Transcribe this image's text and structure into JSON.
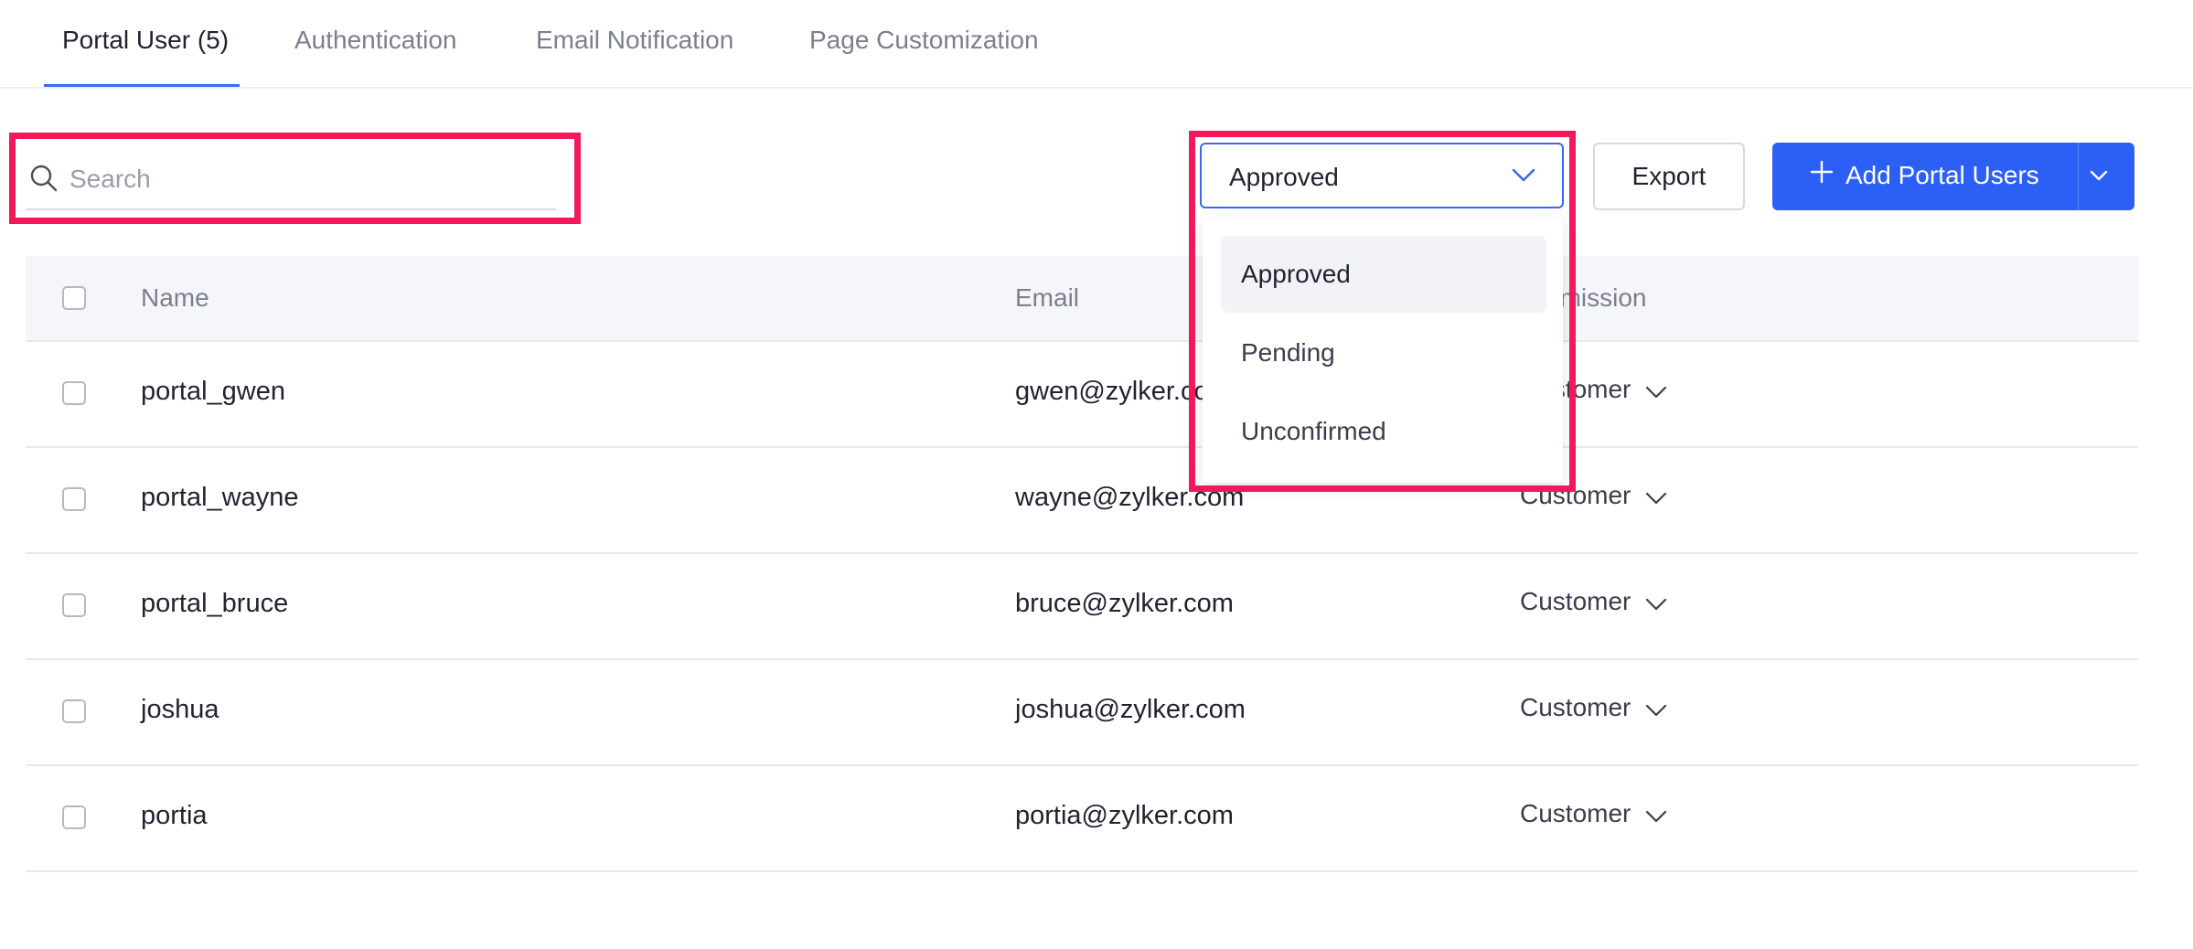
{
  "tabs": [
    {
      "label": "Portal User (5)",
      "active": true
    },
    {
      "label": "Authentication",
      "active": false
    },
    {
      "label": "Email Notification",
      "active": false
    },
    {
      "label": "Page Customization",
      "active": false
    }
  ],
  "search": {
    "placeholder": "Search",
    "value": ""
  },
  "filter": {
    "selected": "Approved",
    "options": [
      "Approved",
      "Pending",
      "Unconfirmed"
    ]
  },
  "toolbar": {
    "export_label": "Export",
    "add_label": "Add Portal Users"
  },
  "table": {
    "headers": {
      "name": "Name",
      "email": "Email",
      "permission": "Permission"
    },
    "rows": [
      {
        "name": "portal_gwen",
        "email": "gwen@zylker.com",
        "permission": "Customer"
      },
      {
        "name": "portal_wayne",
        "email": "wayne@zylker.com",
        "permission": "Customer"
      },
      {
        "name": "portal_bruce",
        "email": "bruce@zylker.com",
        "permission": "Customer"
      },
      {
        "name": "joshua",
        "email": "joshua@zylker.com",
        "permission": "Customer"
      },
      {
        "name": "portia",
        "email": "portia@zylker.com",
        "permission": "Customer"
      }
    ]
  },
  "colors": {
    "accent": "#2c5ff6",
    "highlight": "#f2185b"
  }
}
